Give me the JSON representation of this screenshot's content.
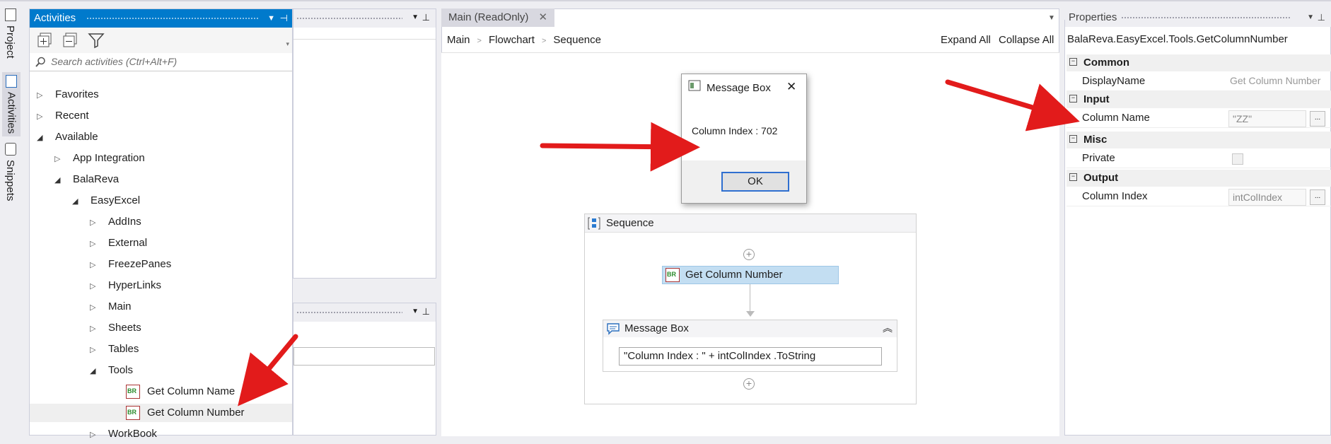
{
  "sidebar_tabs": [
    "Project",
    "Activities",
    "Snippets"
  ],
  "activities": {
    "title": "Activities",
    "search_placeholder": "Search activities (Ctrl+Alt+F)",
    "tree": [
      {
        "label": "Favorites",
        "level": 0,
        "state": "collapsed"
      },
      {
        "label": "Recent",
        "level": 0,
        "state": "collapsed"
      },
      {
        "label": "Available",
        "level": 0,
        "state": "expanded"
      },
      {
        "label": "App Integration",
        "level": 1,
        "state": "collapsed"
      },
      {
        "label": "BalaReva",
        "level": 1,
        "state": "expanded"
      },
      {
        "label": "EasyExcel",
        "level": 2,
        "state": "expanded"
      },
      {
        "label": "AddIns",
        "level": 3,
        "state": "collapsed"
      },
      {
        "label": "External",
        "level": 3,
        "state": "collapsed"
      },
      {
        "label": "FreezePanes",
        "level": 3,
        "state": "collapsed"
      },
      {
        "label": "HyperLinks",
        "level": 3,
        "state": "collapsed"
      },
      {
        "label": "Main",
        "level": 3,
        "state": "collapsed"
      },
      {
        "label": "Sheets",
        "level": 3,
        "state": "collapsed"
      },
      {
        "label": "Tables",
        "level": 3,
        "state": "collapsed"
      },
      {
        "label": "Tools",
        "level": 3,
        "state": "expanded"
      },
      {
        "label": "Get Column Name",
        "level": 4,
        "state": "leaf"
      },
      {
        "label": "Get Column Number",
        "level": 4,
        "state": "leaf",
        "selected": true
      },
      {
        "label": "WorkBook",
        "level": 3,
        "state": "collapsed"
      }
    ],
    "activity_icon_text": "BR"
  },
  "designer": {
    "tab_label": "Main (ReadOnly)",
    "breadcrumb": [
      "Main",
      "Flowchart",
      "Sequence"
    ],
    "expand_all": "Expand All",
    "collapse_all": "Collapse All",
    "sequence_title": "Sequence",
    "activity_label": "Get Column Number",
    "message_box_title": "Message Box",
    "message_box_expression": "\"Column Index : \"  + intColIndex .ToString"
  },
  "dialog": {
    "title": "Message Box",
    "message": "Column Index : 702",
    "ok_label": "OK"
  },
  "properties": {
    "title": "Properties",
    "type_name": "BalaReva.EasyExcel.Tools.GetColumnNumber",
    "categories": [
      {
        "name": "Common",
        "rows": [
          {
            "name": "DisplayName",
            "value": "Get Column Number"
          }
        ]
      },
      {
        "name": "Input",
        "rows": [
          {
            "name": "Column Name",
            "value": "\"ZZ\""
          }
        ]
      },
      {
        "name": "Misc",
        "rows": [
          {
            "name": "Private",
            "value": ""
          }
        ]
      },
      {
        "name": "Output",
        "rows": [
          {
            "name": "Column Index",
            "value": "intColIndex"
          }
        ]
      }
    ]
  },
  "colors": {
    "accent": "#007acc",
    "arrow": "#e21b1b",
    "selected_activity": "#c3def2"
  }
}
